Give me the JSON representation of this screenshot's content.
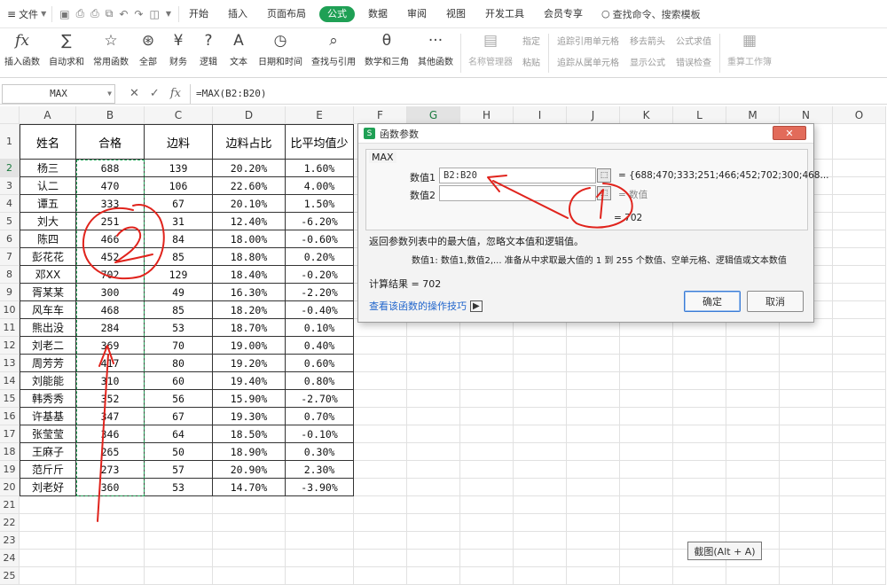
{
  "menubar": {
    "file": "文件",
    "tabs": [
      "开始",
      "插入",
      "页面布局",
      "公式",
      "数据",
      "审阅",
      "视图",
      "开发工具",
      "会员专享"
    ],
    "active_tab": "公式",
    "search": "查找命令、搜索模板"
  },
  "ribbon": {
    "insert_function": "插入函数",
    "autosum": "自动求和",
    "common": "常用函数",
    "all": "全部",
    "finance": "财务",
    "logic": "逻辑",
    "text": "文本",
    "datetime": "日期和时间",
    "lookup": "查找与引用",
    "math": "数学和三角",
    "other": "其他函数",
    "name_manager": "名称管理器",
    "specify": "指定",
    "paste": "粘贴",
    "trace_precedents": "追踪引用单元格",
    "trace_dependents": "追踪从属单元格",
    "remove_arrows": "移去箭头",
    "show_formula": "显示公式",
    "evaluate": "公式求值",
    "error_check": "错误检查",
    "recalc": "重算工作簿"
  },
  "formula_bar": {
    "name_box": "MAX",
    "formula": "=MAX(B2:B20)"
  },
  "columns": [
    "A",
    "B",
    "C",
    "D",
    "E",
    "F",
    "G",
    "H",
    "I",
    "J",
    "K",
    "L",
    "M",
    "N",
    "O"
  ],
  "rows": [
    "1",
    "2",
    "3",
    "4",
    "5",
    "6",
    "7",
    "8",
    "9",
    "10",
    "11",
    "12",
    "13",
    "14",
    "15",
    "16",
    "17",
    "18",
    "19",
    "20",
    "21",
    "22",
    "23",
    "24",
    "25"
  ],
  "table": {
    "headers": [
      "姓名",
      "合格",
      "边料",
      "边料占比",
      "比平均值少"
    ],
    "rows": [
      [
        "杨三",
        "688",
        "139",
        "20.20%",
        "1.60%"
      ],
      [
        "认二",
        "470",
        "106",
        "22.60%",
        "4.00%"
      ],
      [
        "谭五",
        "333",
        "67",
        "20.10%",
        "1.50%"
      ],
      [
        "刘大",
        "251",
        "31",
        "12.40%",
        "-6.20%"
      ],
      [
        "陈四",
        "466",
        "84",
        "18.00%",
        "-0.60%"
      ],
      [
        "彭花花",
        "452",
        "85",
        "18.80%",
        "0.20%"
      ],
      [
        "邓XX",
        "702",
        "129",
        "18.40%",
        "-0.20%"
      ],
      [
        "胥某某",
        "300",
        "49",
        "16.30%",
        "-2.20%"
      ],
      [
        "风车车",
        "468",
        "85",
        "18.20%",
        "-0.40%"
      ],
      [
        "熊出没",
        "284",
        "53",
        "18.70%",
        "0.10%"
      ],
      [
        "刘老二",
        "369",
        "70",
        "19.00%",
        "0.40%"
      ],
      [
        "周芳芳",
        "417",
        "80",
        "19.20%",
        "0.60%"
      ],
      [
        "刘能能",
        "310",
        "60",
        "19.40%",
        "0.80%"
      ],
      [
        "韩秀秀",
        "352",
        "56",
        "15.90%",
        "-2.70%"
      ],
      [
        "许基基",
        "347",
        "67",
        "19.30%",
        "0.70%"
      ],
      [
        "张莹莹",
        "346",
        "64",
        "18.50%",
        "-0.10%"
      ],
      [
        "王麻子",
        "265",
        "50",
        "18.90%",
        "0.30%"
      ],
      [
        "范斤斤",
        "273",
        "57",
        "20.90%",
        "2.30%"
      ],
      [
        "刘老好",
        "360",
        "53",
        "14.70%",
        "-3.90%"
      ]
    ]
  },
  "dialog": {
    "title": "函数参数",
    "function_name": "MAX",
    "arg1_label": "数值1",
    "arg1_value": "B2:B20",
    "arg1_result": "= {688;470;333;251;466;452;702;300;468...",
    "arg2_label": "数值2",
    "arg2_result": "= 数值",
    "total": "= 702",
    "description": "返回参数列表中的最大值，忽略文本值和逻辑值。",
    "arg_desc": "数值1:   数值1,数值2,... 准备从中求取最大值的 1 到 255 个数值、空单元格、逻辑值或文本数值",
    "calc_result": "计算结果 = 702",
    "help_link": "查看该函数的操作技巧",
    "ok": "确定",
    "cancel": "取消"
  },
  "tooltip": "截图(Alt + A)",
  "annotation_color": "#e0231c"
}
